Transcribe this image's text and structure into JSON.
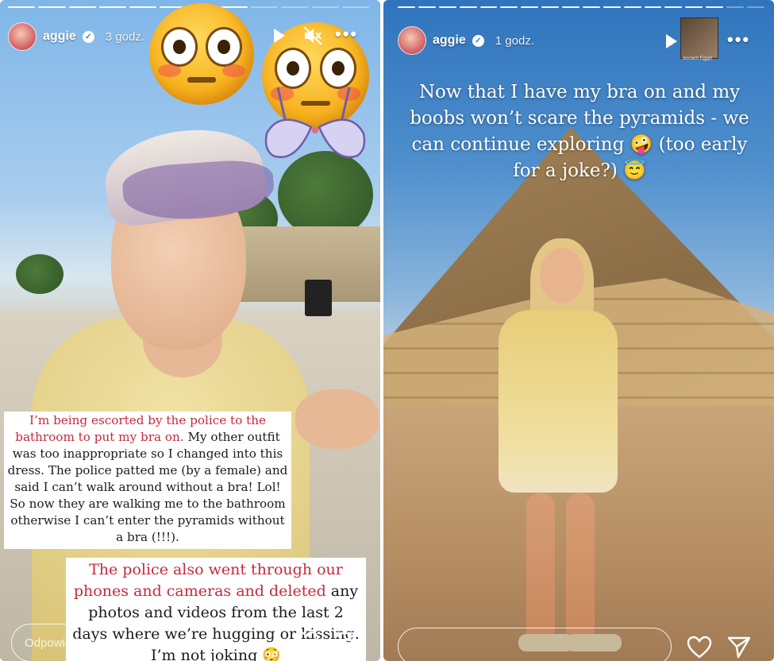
{
  "left_story": {
    "username": "aggie",
    "time": "3 godz.",
    "caption_red": "I’m being escorted by the police to the bathroom to put my bra on.",
    "caption_rest": "My other outfit was too inappropriate so I changed into this dress. The police patted me (by a female) and said I can’t walk around without a bra! Lol! So now they are walking me to the bathroom otherwise I can’t enter the pyramids without a bra (!!!).",
    "caption2_red": "The police also went through our phones and cameras and deleted",
    "caption2_rest": "any photos and videos from the last 2 days where we’re hugging or kissing. I’m not joking 😳",
    "reply_placeholder": "Odpowiedz użytkownikowi aggie...",
    "progress_segments": 12,
    "progress_done": 8
  },
  "right_story": {
    "username": "aggie",
    "time": "1 godz.",
    "headline": "Now that I have my bra on and my boobs won’t scare the pyramids - we can continue exploring 🤪 (too early for a joke?) 😇",
    "music_sticker_label": "Ancient Egypt",
    "progress_segments": 18,
    "progress_done": 16
  },
  "icons": {
    "play": "play-icon",
    "mute": "speaker-muted-icon",
    "more": "more-options-icon",
    "heart": "heart-icon",
    "send": "send-icon",
    "verified": "verified-badge-icon"
  },
  "colors": {
    "caption_red": "#c8283d",
    "verified_blue": "#3d7fd6"
  }
}
